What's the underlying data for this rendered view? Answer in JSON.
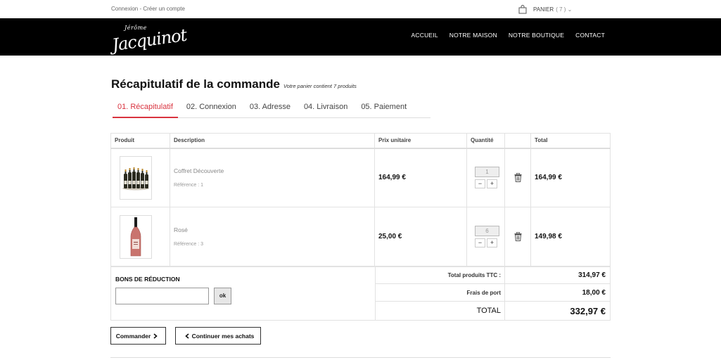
{
  "topbar": {
    "account_links": "Connexion - Créer un compte",
    "cart_label": "PANIER",
    "cart_count": "( 7 ) ⌄"
  },
  "header": {
    "logo_small": "Jérôme",
    "logo_main": "Jacquinot",
    "nav": [
      "ACCUEIL",
      "NOTRE MAISON",
      "NOTRE BOUTIQUE",
      "CONTACT"
    ]
  },
  "page": {
    "title": "Récapitulatif de la commande",
    "subtitle": "Votre panier contient 7 produits"
  },
  "steps": [
    "01. Récapitulatif",
    "02. Connexion",
    "03. Adresse",
    "04. Livraison",
    "05. Paiement"
  ],
  "table": {
    "headers": [
      "Produit",
      "Description",
      "Prix unitaire",
      "Quantité",
      "",
      "Total"
    ],
    "rows": [
      {
        "name": "Coffret Découverte",
        "ref": "Référence : 1",
        "price": "164,99 €",
        "qty": "1",
        "total": "164,99 €"
      },
      {
        "name": "Rosé",
        "ref": "Référence : 3",
        "price": "25,00 €",
        "qty": "6",
        "total": "149,98 €"
      }
    ]
  },
  "voucher": {
    "title": "BONS DE RÉDUCTION",
    "placeholder": "",
    "ok_label": "ok"
  },
  "totals": {
    "products_label": "Total produits TTC :",
    "products_value": "314,97 €",
    "shipping_label": "Frais de port",
    "shipping_value": "18,00 €",
    "grand_label": "TOTAL",
    "grand_value": "332,97 €"
  },
  "actions": {
    "order_label": "Commander",
    "continue_label": "Continuer mes achats"
  },
  "colors": {
    "accent": "#d9333f",
    "header_bg": "#000000"
  }
}
